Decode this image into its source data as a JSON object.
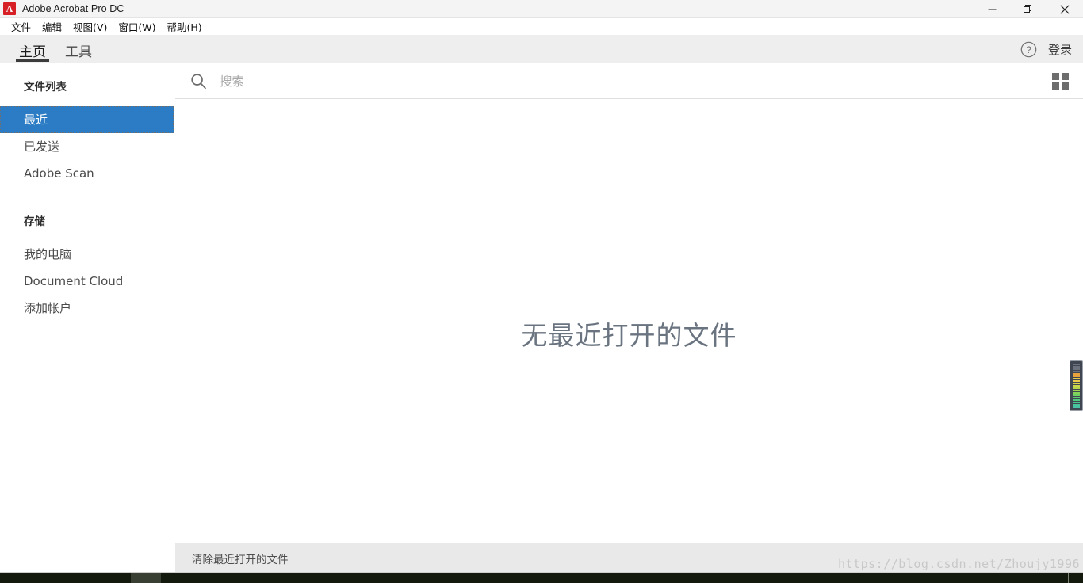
{
  "window": {
    "title": "Adobe Acrobat Pro DC",
    "logo_icon": "acrobat-logo-icon",
    "logo_glyph": "A",
    "controls": {
      "minimize": "minimize-icon",
      "restore": "restore-icon",
      "close": "close-icon"
    }
  },
  "menubar": {
    "items": [
      {
        "label": "文件"
      },
      {
        "label": "编辑"
      },
      {
        "label": "视图(V)"
      },
      {
        "label": "窗口(W)"
      },
      {
        "label": "帮助(H)"
      }
    ]
  },
  "tabbar": {
    "tabs": [
      {
        "label": "主页",
        "active": true
      },
      {
        "label": "工具",
        "active": false
      }
    ],
    "help_icon": "help-circle-icon",
    "signin_label": "登录"
  },
  "sidebar": {
    "sections": [
      {
        "title": "文件列表",
        "items": [
          {
            "label": "最近",
            "selected": true
          },
          {
            "label": "已发送",
            "selected": false
          },
          {
            "label": "Adobe Scan",
            "selected": false
          }
        ]
      },
      {
        "title": "存储",
        "items": [
          {
            "label": "我的电脑",
            "selected": false
          },
          {
            "label": "Document Cloud",
            "selected": false
          },
          {
            "label": "添加帐户",
            "selected": false
          }
        ]
      }
    ]
  },
  "content": {
    "search": {
      "icon": "search-icon",
      "placeholder": "搜索",
      "value": ""
    },
    "view_toggle_icon": "grid-view-icon",
    "empty_state_text": "无最近打开的文件",
    "clear_recent_label": "清除最近打开的文件"
  },
  "overlay": {
    "watermark": "https://blog.csdn.net/Zhoujy1996",
    "level_meter": {
      "name": "volume-level-meter",
      "segments": [
        "#6b727e",
        "#6b727e",
        "#6b727e",
        "#6b727e",
        "#e8a33d",
        "#e8a33d",
        "#e8c94a",
        "#e8c94a",
        "#d9d34a",
        "#c9d44a",
        "#b6d44a",
        "#9fd34f",
        "#86d159",
        "#6fcf63",
        "#5ccb70",
        "#4fc97e",
        "#4ac68c",
        "#49c39a",
        "#4ac0a5"
      ]
    }
  },
  "colors": {
    "accent_blue": "#2b7cc4",
    "logo_red": "#d71f26",
    "tabbar_bg": "#eeeeee",
    "bottombar_bg": "#e9e9e9",
    "empty_text": "#6a7480"
  }
}
